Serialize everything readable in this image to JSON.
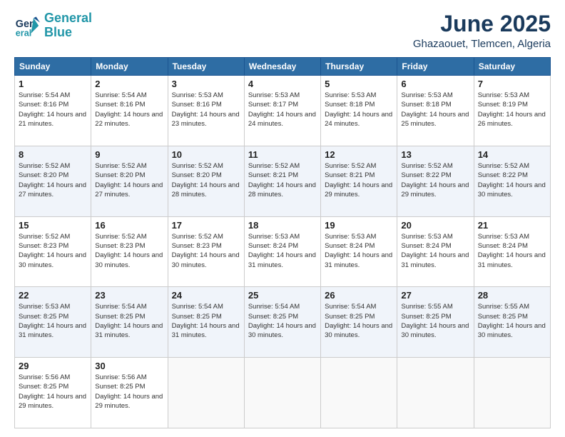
{
  "logo": {
    "line1": "General",
    "line2": "Blue"
  },
  "title": "June 2025",
  "location": "Ghazaouet, Tlemcen, Algeria",
  "headers": [
    "Sunday",
    "Monday",
    "Tuesday",
    "Wednesday",
    "Thursday",
    "Friday",
    "Saturday"
  ],
  "weeks": [
    [
      {
        "day": "1",
        "rise": "5:54 AM",
        "set": "8:16 PM",
        "daylight": "14 hours and 21 minutes."
      },
      {
        "day": "2",
        "rise": "5:54 AM",
        "set": "8:16 PM",
        "daylight": "14 hours and 22 minutes."
      },
      {
        "day": "3",
        "rise": "5:53 AM",
        "set": "8:16 PM",
        "daylight": "14 hours and 23 minutes."
      },
      {
        "day": "4",
        "rise": "5:53 AM",
        "set": "8:17 PM",
        "daylight": "14 hours and 24 minutes."
      },
      {
        "day": "5",
        "rise": "5:53 AM",
        "set": "8:18 PM",
        "daylight": "14 hours and 24 minutes."
      },
      {
        "day": "6",
        "rise": "5:53 AM",
        "set": "8:18 PM",
        "daylight": "14 hours and 25 minutes."
      },
      {
        "day": "7",
        "rise": "5:53 AM",
        "set": "8:19 PM",
        "daylight": "14 hours and 26 minutes."
      }
    ],
    [
      {
        "day": "8",
        "rise": "5:52 AM",
        "set": "8:20 PM",
        "daylight": "14 hours and 27 minutes."
      },
      {
        "day": "9",
        "rise": "5:52 AM",
        "set": "8:20 PM",
        "daylight": "14 hours and 27 minutes."
      },
      {
        "day": "10",
        "rise": "5:52 AM",
        "set": "8:20 PM",
        "daylight": "14 hours and 28 minutes."
      },
      {
        "day": "11",
        "rise": "5:52 AM",
        "set": "8:21 PM",
        "daylight": "14 hours and 28 minutes."
      },
      {
        "day": "12",
        "rise": "5:52 AM",
        "set": "8:21 PM",
        "daylight": "14 hours and 29 minutes."
      },
      {
        "day": "13",
        "rise": "5:52 AM",
        "set": "8:22 PM",
        "daylight": "14 hours and 29 minutes."
      },
      {
        "day": "14",
        "rise": "5:52 AM",
        "set": "8:22 PM",
        "daylight": "14 hours and 30 minutes."
      }
    ],
    [
      {
        "day": "15",
        "rise": "5:52 AM",
        "set": "8:23 PM",
        "daylight": "14 hours and 30 minutes."
      },
      {
        "day": "16",
        "rise": "5:52 AM",
        "set": "8:23 PM",
        "daylight": "14 hours and 30 minutes."
      },
      {
        "day": "17",
        "rise": "5:52 AM",
        "set": "8:23 PM",
        "daylight": "14 hours and 30 minutes."
      },
      {
        "day": "18",
        "rise": "5:53 AM",
        "set": "8:24 PM",
        "daylight": "14 hours and 31 minutes."
      },
      {
        "day": "19",
        "rise": "5:53 AM",
        "set": "8:24 PM",
        "daylight": "14 hours and 31 minutes."
      },
      {
        "day": "20",
        "rise": "5:53 AM",
        "set": "8:24 PM",
        "daylight": "14 hours and 31 minutes."
      },
      {
        "day": "21",
        "rise": "5:53 AM",
        "set": "8:24 PM",
        "daylight": "14 hours and 31 minutes."
      }
    ],
    [
      {
        "day": "22",
        "rise": "5:53 AM",
        "set": "8:25 PM",
        "daylight": "14 hours and 31 minutes."
      },
      {
        "day": "23",
        "rise": "5:54 AM",
        "set": "8:25 PM",
        "daylight": "14 hours and 31 minutes."
      },
      {
        "day": "24",
        "rise": "5:54 AM",
        "set": "8:25 PM",
        "daylight": "14 hours and 31 minutes."
      },
      {
        "day": "25",
        "rise": "5:54 AM",
        "set": "8:25 PM",
        "daylight": "14 hours and 30 minutes."
      },
      {
        "day": "26",
        "rise": "5:54 AM",
        "set": "8:25 PM",
        "daylight": "14 hours and 30 minutes."
      },
      {
        "day": "27",
        "rise": "5:55 AM",
        "set": "8:25 PM",
        "daylight": "14 hours and 30 minutes."
      },
      {
        "day": "28",
        "rise": "5:55 AM",
        "set": "8:25 PM",
        "daylight": "14 hours and 30 minutes."
      }
    ],
    [
      {
        "day": "29",
        "rise": "5:56 AM",
        "set": "8:25 PM",
        "daylight": "14 hours and 29 minutes."
      },
      {
        "day": "30",
        "rise": "5:56 AM",
        "set": "8:25 PM",
        "daylight": "14 hours and 29 minutes."
      },
      null,
      null,
      null,
      null,
      null
    ]
  ]
}
